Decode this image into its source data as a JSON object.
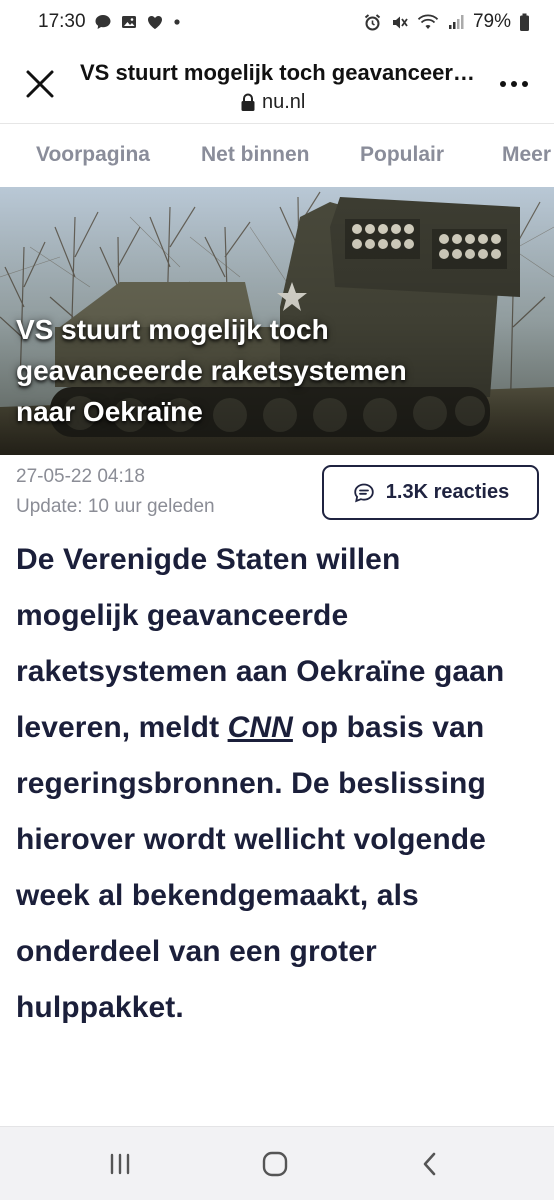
{
  "status_bar": {
    "time": "17:30",
    "battery": "79%",
    "left_icons": [
      "chat-bubble-icon",
      "image-icon",
      "heart-icon",
      "dot-icon"
    ],
    "right_icons": [
      "alarm-icon",
      "mute-icon",
      "wifi-icon",
      "signal-icon",
      "battery-icon"
    ]
  },
  "browser": {
    "title": "VS stuurt mogelijk toch geavanceerde raketsystemen naar Oekraïne",
    "url": "nu.nl"
  },
  "nav_tabs": [
    "Voorpagina",
    "Net binnen",
    "Populair",
    "Meer"
  ],
  "article": {
    "title_lines": [
      "VS stuurt mogelijk toch",
      "geavanceerde raketsystemen",
      "naar Oekraïne"
    ],
    "date": "27-05-22 04:18",
    "update": "Update: 10 uur geleden",
    "reactions": "1.3K reacties",
    "body_lines": [
      "De Verenigde Staten willen",
      "mogelijk geavanceerde",
      "raketsystemen aan Oekraïne gaan",
      "leveren, meldt",
      "CNN",
      "op basis van",
      "regeringsbronnen. De beslissing",
      "hierover wordt wellicht volgende",
      "week al bekendgemaakt, als",
      "onderdeel van een groter",
      "hulppakket."
    ]
  },
  "colors": {
    "text_dark": "#1b1f3a",
    "tab_gray": "#8a8d9a",
    "meta_gray": "#8b8d96"
  }
}
